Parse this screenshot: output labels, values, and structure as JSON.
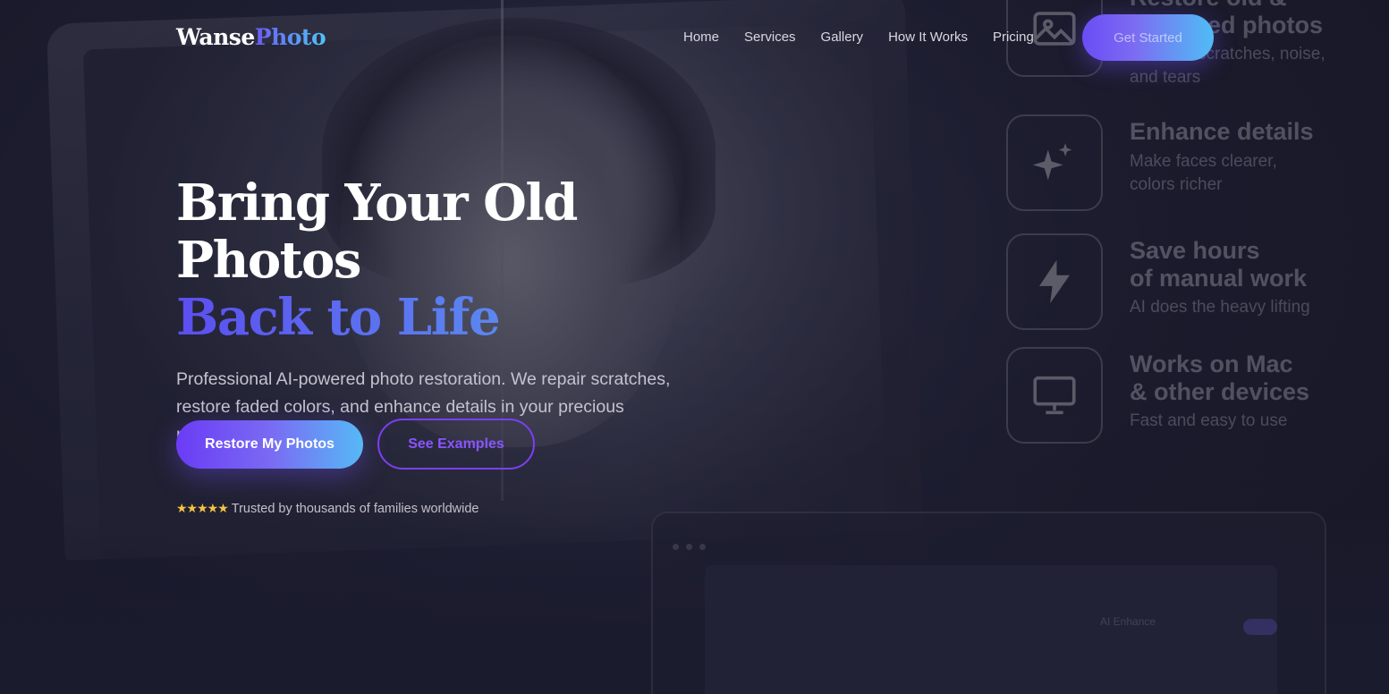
{
  "brand": {
    "part1": "Wanse",
    "part2": "Photo"
  },
  "nav": {
    "links": [
      "Home",
      "Services",
      "Gallery",
      "How It Works",
      "Pricing"
    ],
    "cta_label": "Get Started"
  },
  "hero": {
    "title_line1": "Bring Your Old Photos",
    "title_line2": "Back to Life",
    "subtitle": "Professional AI-powered photo restoration. We repair scratches, restore faded colors, and enhance details in your precious memories.",
    "primary_button": "Restore My Photos",
    "secondary_button": "See Examples",
    "trust_stars": "★★★★★",
    "trust_text": "Trusted by thousands of families worldwide"
  },
  "features": [
    {
      "icon": "image-icon",
      "title": "Restore old &\ndamaged photos",
      "desc": "Remove scratches, noise,\nand tears"
    },
    {
      "icon": "sparkle-icon",
      "title": "Enhance details",
      "desc": "Make faces clearer,\ncolors richer"
    },
    {
      "icon": "lightning-icon",
      "title": "Save hours\nof manual work",
      "desc": "AI does the heavy lifting"
    },
    {
      "icon": "monitor-icon",
      "title": "Works on Mac\n& other devices",
      "desc": "Fast and easy to use"
    }
  ],
  "preview": {
    "toggle_label": "AI Enhance"
  },
  "colors": {
    "accent_purple": "#6a4cf5",
    "accent_blue": "#4fbdf5",
    "star_gold": "#f6c342",
    "background": "#1b1b2e"
  }
}
